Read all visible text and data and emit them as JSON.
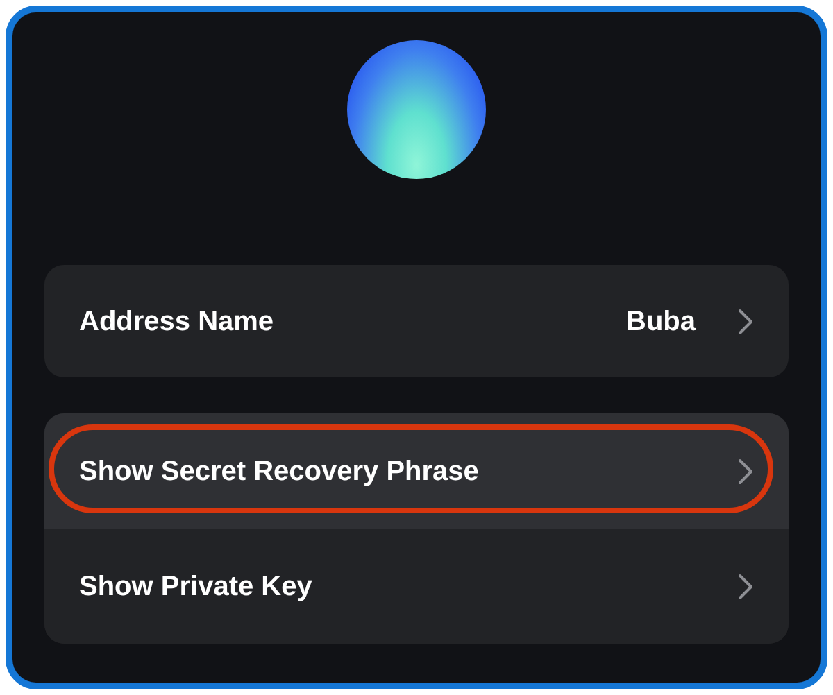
{
  "account": {
    "name_row": {
      "label": "Address Name",
      "value": "Buba"
    }
  },
  "actions": [
    {
      "label": "Show Secret Recovery Phrase",
      "selected": true,
      "circled": true
    },
    {
      "label": "Show Private Key",
      "selected": false,
      "circled": false
    }
  ]
}
